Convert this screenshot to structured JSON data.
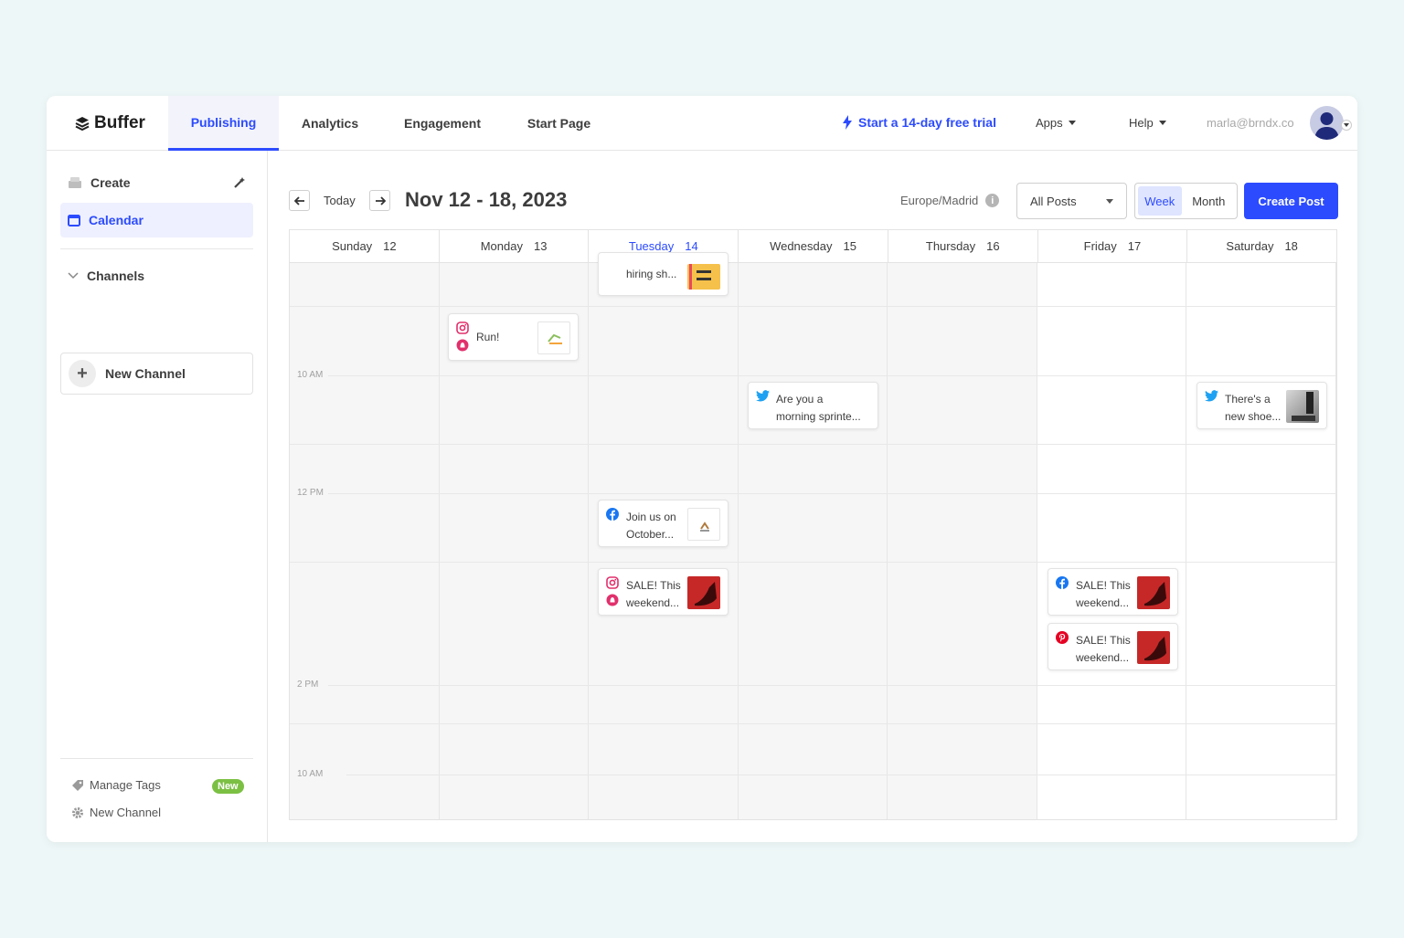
{
  "app": {
    "brand": "Buffer"
  },
  "nav": {
    "tabs": [
      {
        "label": "Publishing"
      },
      {
        "label": "Analytics"
      },
      {
        "label": "Engagement"
      },
      {
        "label": "Start Page"
      }
    ],
    "trial": "Start a 14-day free trial",
    "apps": "Apps",
    "help": "Help",
    "email": "marla@brndx.co"
  },
  "sidebar": {
    "create": "Create",
    "calendar": "Calendar",
    "channels": "Channels",
    "new_channel": "New Channel",
    "manage_tags": "Manage Tags",
    "new_badge": "New",
    "footer_new_channel": "New Channel"
  },
  "toolbar": {
    "today": "Today",
    "range": "Nov 12 - 18, 2023",
    "timezone": "Europe/Madrid",
    "filter": "All Posts",
    "view_week": "Week",
    "view_month": "Month",
    "create_post": "Create Post"
  },
  "calendar": {
    "days": [
      {
        "name": "Sunday",
        "num": "12"
      },
      {
        "name": "Monday",
        "num": "13"
      },
      {
        "name": "Tuesday",
        "num": "14"
      },
      {
        "name": "Wednesday",
        "num": "15"
      },
      {
        "name": "Thursday",
        "num": "16"
      },
      {
        "name": "Friday",
        "num": "17"
      },
      {
        "name": "Saturday",
        "num": "18"
      }
    ],
    "time_labels": [
      "10 AM",
      "12 PM",
      "2 PM",
      "10 AM"
    ],
    "posts": {
      "tue_hiring": {
        "l1": "hiring sh..."
      },
      "mon_run": {
        "l1": "Run!"
      },
      "wed_sprinter": {
        "l1": "Are you a",
        "l2": "morning sprinte..."
      },
      "sat_shoe": {
        "l1": "There's a",
        "l2": "new shoe..."
      },
      "tue_october": {
        "l1": "Join us on",
        "l2": "October..."
      },
      "tue_sale": {
        "l1": "SALE! This",
        "l2": "weekend..."
      },
      "fri_sale_fb": {
        "l1": "SALE! This",
        "l2": "weekend..."
      },
      "fri_sale_pin": {
        "l1": "SALE! This",
        "l2": "weekend..."
      }
    }
  },
  "colors": {
    "accent": "#2c4bff",
    "instagram": "#e1306c",
    "facebook": "#1877f2",
    "twitter": "#1da1f2",
    "pinterest": "#e60023",
    "new_badge": "#7bc043"
  },
  "icons": [
    "stack-logo-icon",
    "lightning-icon",
    "create-icon",
    "magic-wand-icon",
    "calendar-icon",
    "chevron-down-icon",
    "plus-icon",
    "tag-icon",
    "gear-icon",
    "arrow-left-icon",
    "arrow-right-icon",
    "info-icon",
    "instagram-icon",
    "facebook-icon",
    "twitter-icon",
    "pinterest-icon",
    "avatar"
  ]
}
